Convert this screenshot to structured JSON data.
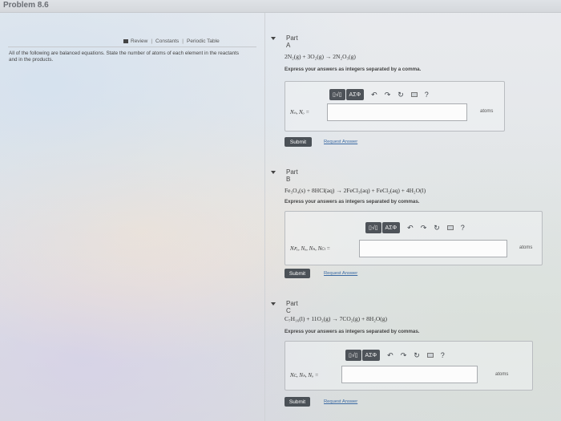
{
  "header": {
    "title": "Problem 8.6"
  },
  "left_pane": {
    "links": {
      "review": "Review",
      "constants": "Constants",
      "periodic_table": "Periodic Table"
    },
    "instruction": "All of the following are balanced equations. State the number of atoms of each element in the reactants and in the products."
  },
  "toolbar": {
    "templates_label": "▯√▯",
    "symbols_label": "ΑΣΦ",
    "undo_icon": "↶",
    "redo_icon": "↷",
    "reset_icon": "↻",
    "keyboard_icon": "▭",
    "help_label": "?"
  },
  "parts": [
    {
      "title": "Part A",
      "equation": "2N₂(g) + 3O₂(g) → 2N₂O₃(g)",
      "express": "Express your answers as integers separated by a comma.",
      "variables": "Nₙ, Nₒ =",
      "input_value": "",
      "unit": "atoms",
      "submit": "Submit",
      "request": "Request Answer"
    },
    {
      "title": "Part B",
      "equation": "Fe₃O₄(s) + 8HCl(aq) → 2FeCl₃(aq) + FeCl₂(aq) + 4H₂O(l)",
      "express": "Express your answers as integers separated by commas.",
      "variables": "Nꜰₑ, Nₒ, Nₕ, Nᴄₗ =",
      "input_value": "",
      "unit": "atoms",
      "submit": "Submit",
      "request": "Request Answer"
    },
    {
      "title": "Part C",
      "equation": "C₇H₁₆(l) + 11O₂(g) → 7CO₂(g) + 8H₂O(g)",
      "express": "Express your answers as integers separated by commas.",
      "variables": "Nᴄ, Nₕ, Nₒ =",
      "input_value": "",
      "unit": "atoms",
      "submit": "Submit",
      "request": "Request Answer"
    }
  ]
}
